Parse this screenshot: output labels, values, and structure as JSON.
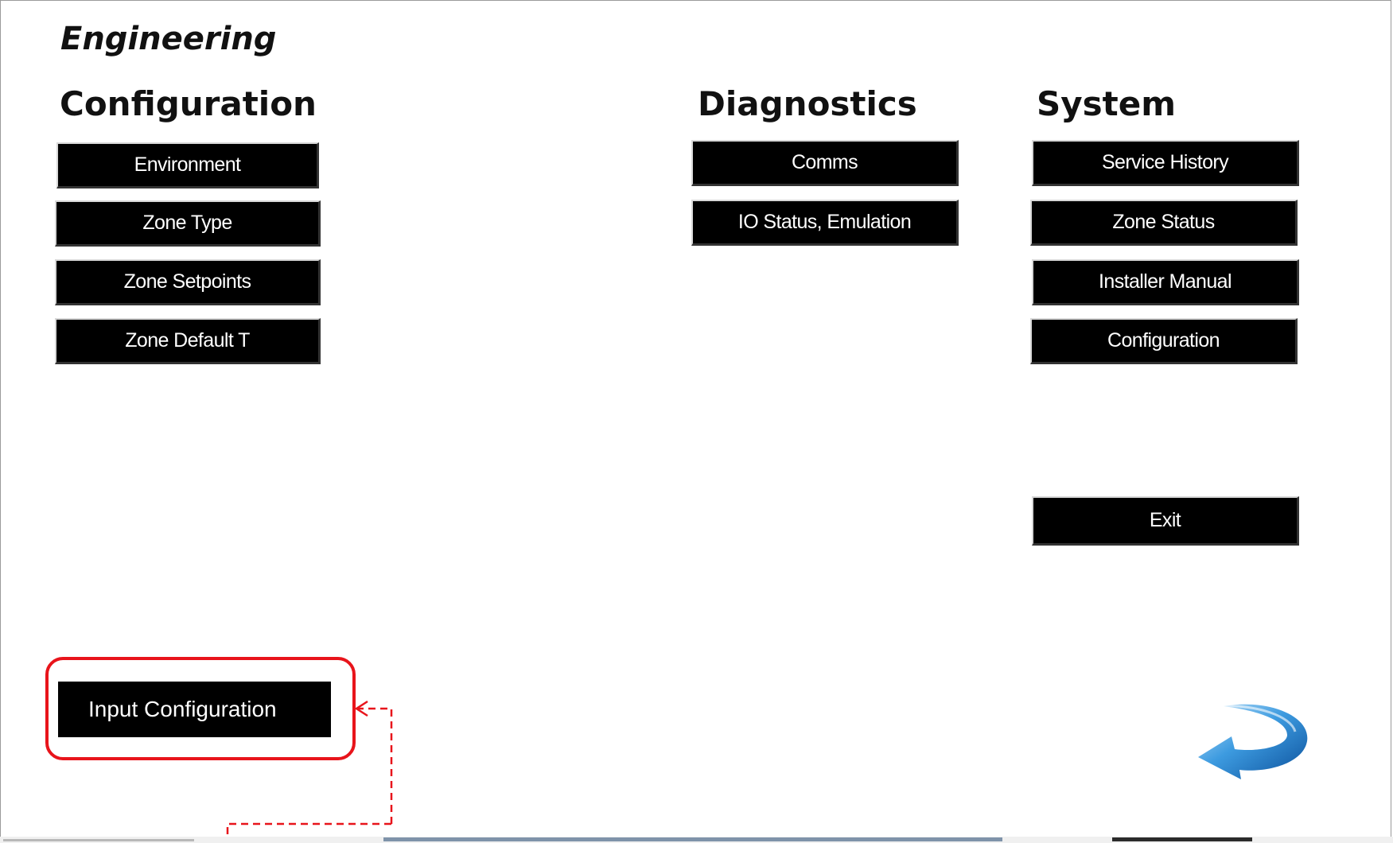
{
  "window": {
    "title": "Engineering"
  },
  "sections": {
    "configuration": {
      "heading": "Configuration",
      "buttons": [
        "Environment",
        "Zone Type",
        "Zone Setpoints",
        "Zone Default T"
      ]
    },
    "diagnostics": {
      "heading": "Diagnostics",
      "buttons": [
        "Comms",
        "IO Status, Emulation"
      ]
    },
    "system": {
      "heading": "System",
      "buttons": [
        "Service History",
        "Zone Status",
        "Installer Manual",
        "Configuration"
      ],
      "exit_label": "Exit"
    }
  },
  "callout": {
    "button_label": "Input Configuration",
    "highlight_color": "#e8141b"
  },
  "icons": {
    "nav": "next-arrow-icon"
  }
}
